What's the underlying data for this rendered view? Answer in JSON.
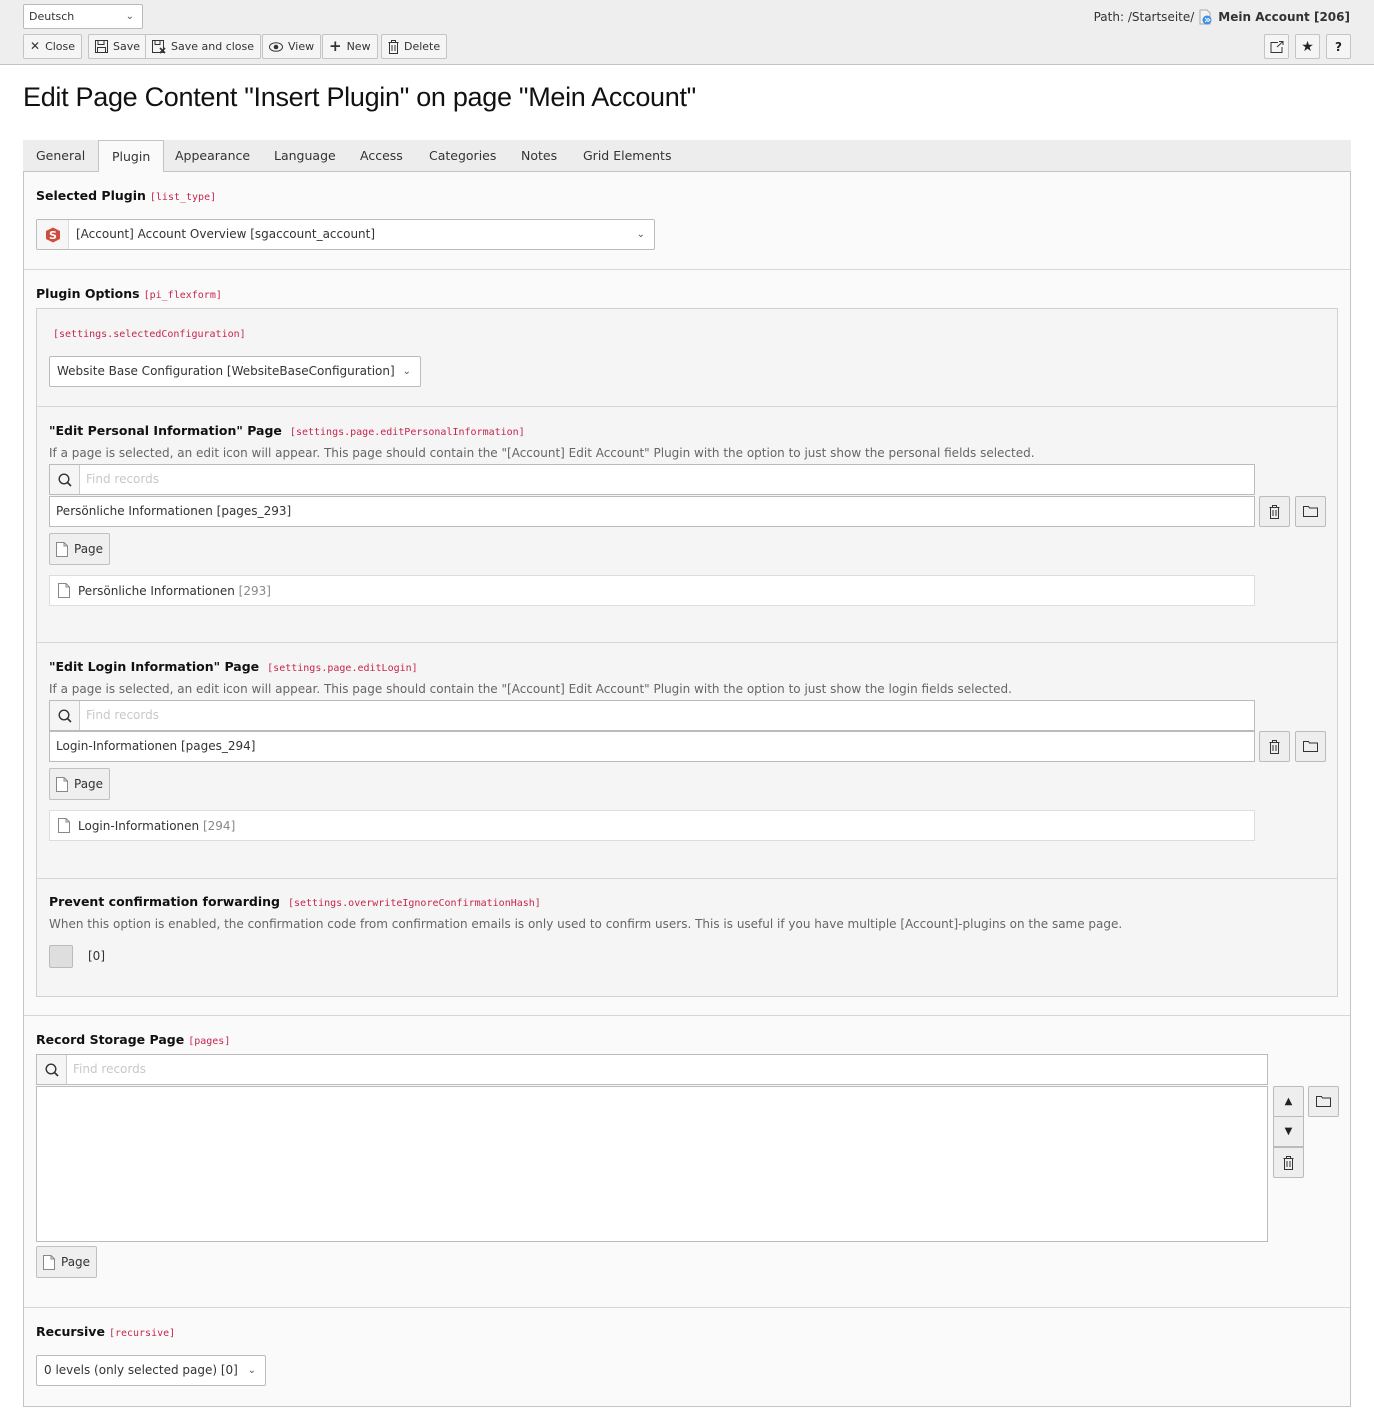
{
  "header": {
    "language_select": "Deutsch",
    "buttons": {
      "close": "Close",
      "save": "Save",
      "save_and_close": "Save and close",
      "view": "View",
      "new": "New",
      "delete": "Delete"
    },
    "path_label": "Path: /Startseite/",
    "path_page": "Mein Account [206]",
    "right_icons": [
      "open-new-window-icon",
      "star-icon",
      "help-icon"
    ],
    "help_label": "?"
  },
  "page_title": "Edit Page Content \"Insert Plugin\" on page \"Mein Account\"",
  "tabs": [
    {
      "label": "General",
      "active": false
    },
    {
      "label": "Plugin",
      "active": true
    },
    {
      "label": "Appearance",
      "active": false
    },
    {
      "label": "Language",
      "active": false
    },
    {
      "label": "Access",
      "active": false
    },
    {
      "label": "Categories",
      "active": false
    },
    {
      "label": "Notes",
      "active": false
    },
    {
      "label": "Grid Elements",
      "active": false
    }
  ],
  "selected_plugin": {
    "label": "Selected Plugin",
    "field": "[list_type]",
    "value": "[Account] Account Overview [sgaccount_account]"
  },
  "plugin_options": {
    "label": "Plugin Options",
    "field": "[pi_flexform]",
    "configuration": {
      "field": "[settings.selectedConfiguration]",
      "value": "Website Base Configuration [WebsiteBaseConfiguration]"
    },
    "edit_personal": {
      "label": "\"Edit Personal Information\" Page",
      "field": "[settings.page.editPersonalInformation]",
      "description": "If a page is selected, an edit icon will appear. This page should contain the \"[Account] Edit Account\" Plugin with the option to just show the personal fields selected.",
      "search_placeholder": "Find records",
      "value": "Persönliche Informationen [pages_293]",
      "page_button": "Page",
      "record_title": "Persönliche Informationen",
      "record_uid": "[293]"
    },
    "edit_login": {
      "label": "\"Edit Login Information\" Page",
      "field": "[settings.page.editLogin]",
      "description": "If a page is selected, an edit icon will appear. This page should contain the \"[Account] Edit Account\" Plugin with the option to just show the login fields selected.",
      "search_placeholder": "Find records",
      "value": "Login-Informationen [pages_294]",
      "page_button": "Page",
      "record_title": "Login-Informationen",
      "record_uid": "[294]"
    },
    "prevent_forwarding": {
      "label": "Prevent confirmation forwarding",
      "field": "[settings.overwriteIgnoreConfirmationHash]",
      "description": "When this option is enabled, the confirmation code from confirmation emails is only used to confirm users. This is useful if you have multiple [Account]-plugins on the same page.",
      "checked": false,
      "value_label": "[0]"
    }
  },
  "record_storage": {
    "label": "Record Storage Page",
    "field": "[pages]",
    "search_placeholder": "Find records",
    "page_button": "Page"
  },
  "recursive": {
    "label": "Recursive",
    "field": "[recursive]",
    "value": "0 levels (only selected page) [0]"
  }
}
